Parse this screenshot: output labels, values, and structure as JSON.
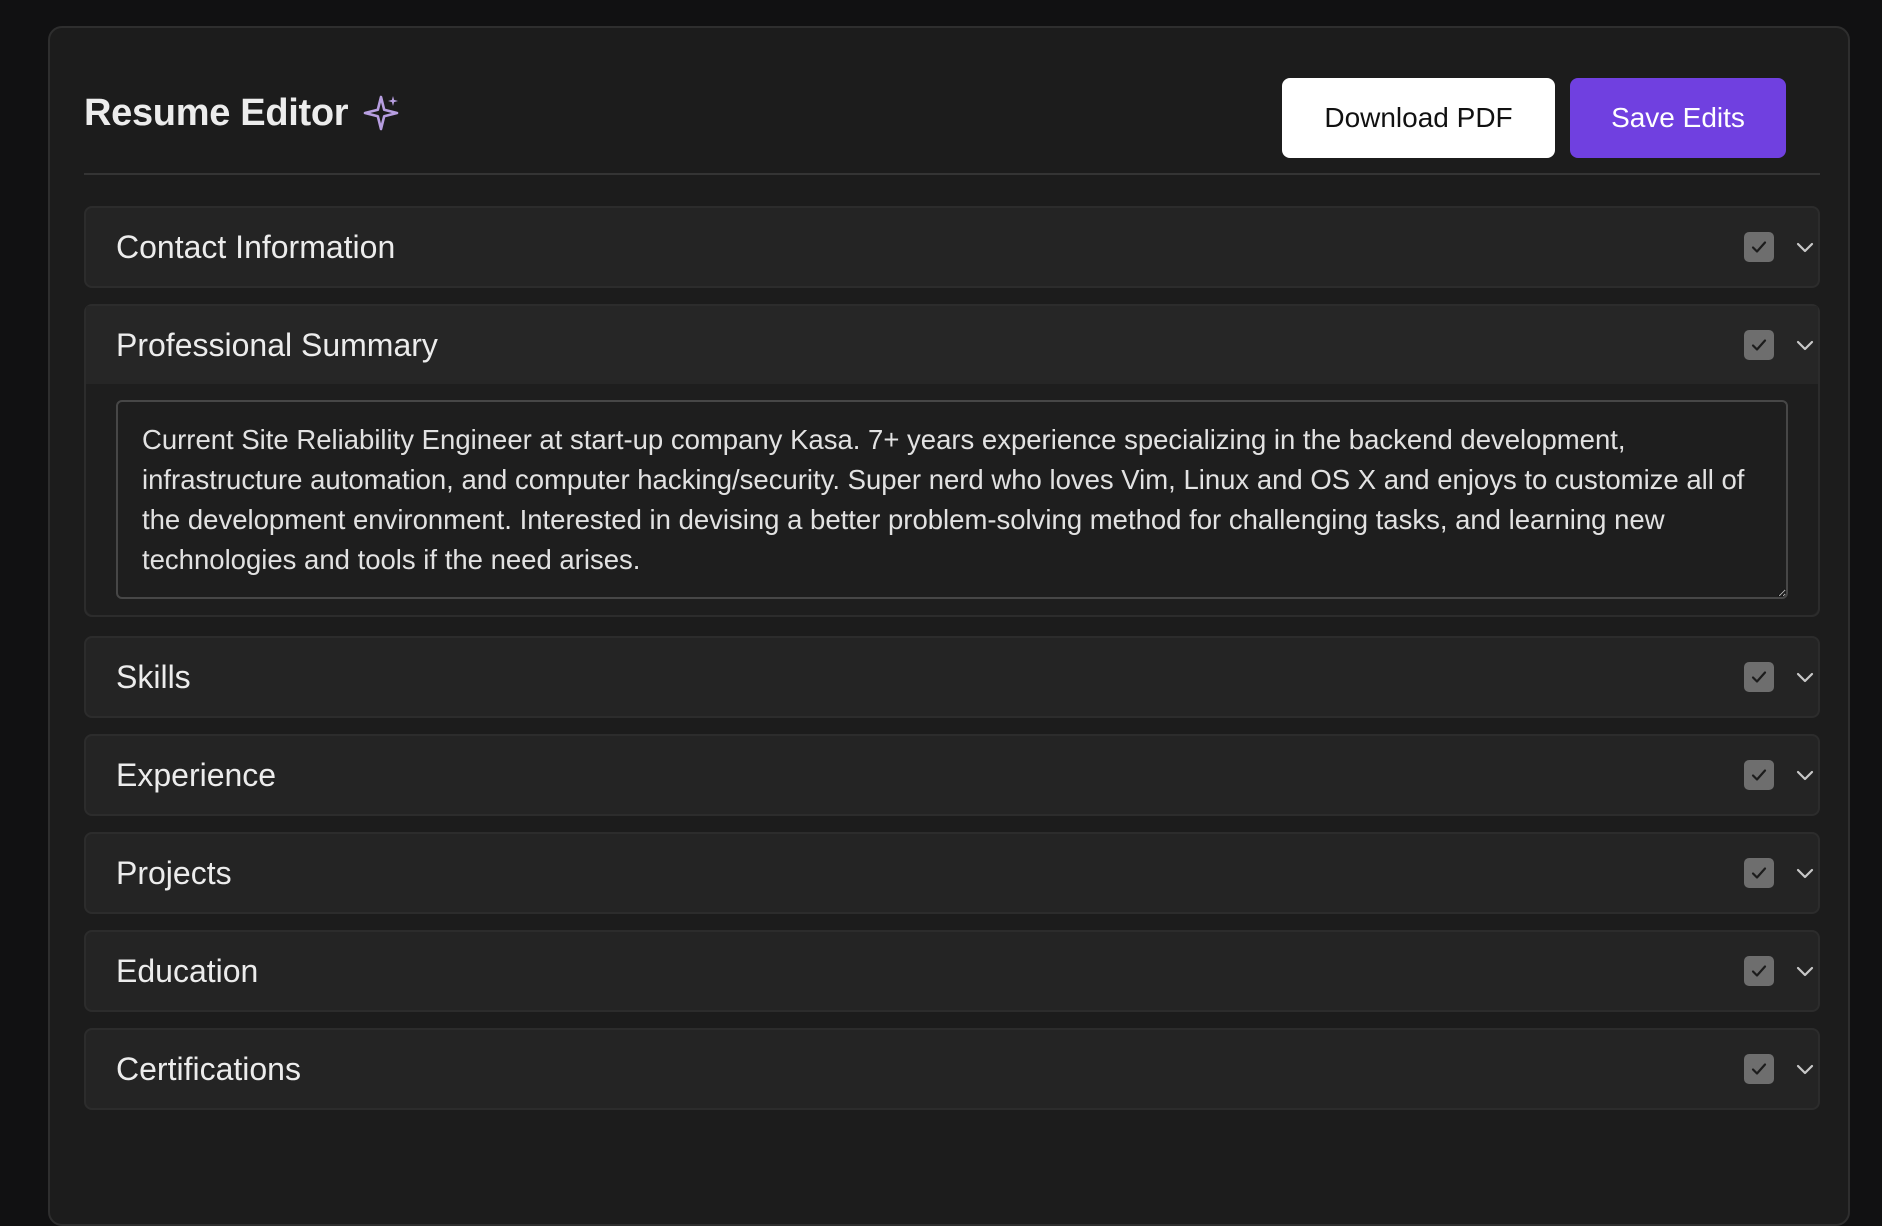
{
  "header": {
    "title": "Resume Editor",
    "download_label": "Download PDF",
    "save_label": "Save Edits"
  },
  "sections": [
    {
      "title": "Contact Information",
      "included": true,
      "expanded": false
    },
    {
      "title": "Professional Summary",
      "included": true,
      "expanded": true
    },
    {
      "title": "Skills",
      "included": true,
      "expanded": false
    },
    {
      "title": "Experience",
      "included": true,
      "expanded": false
    },
    {
      "title": "Projects",
      "included": true,
      "expanded": false
    },
    {
      "title": "Education",
      "included": true,
      "expanded": false
    },
    {
      "title": "Certifications",
      "included": true,
      "expanded": false
    }
  ],
  "summary": {
    "text": "Current Site Reliability Engineer at start-up company Kasa. 7+ years experience specializing in the backend development, infrastructure automation, and computer hacking/security. Super nerd who loves Vim, Linux and OS X and enjoys to customize all of the development environment. Interested in devising a better problem-solving method for challenging tasks, and learning new technologies and tools if the need arises."
  },
  "colors": {
    "accent": "#7040e0",
    "background": "#111112",
    "panel": "#1c1c1c",
    "section": "#242424"
  },
  "icons": {
    "title_icon": "sparkle-icon",
    "section_include": "checkbox-checked-icon",
    "section_toggle": "chevron-down-icon"
  }
}
